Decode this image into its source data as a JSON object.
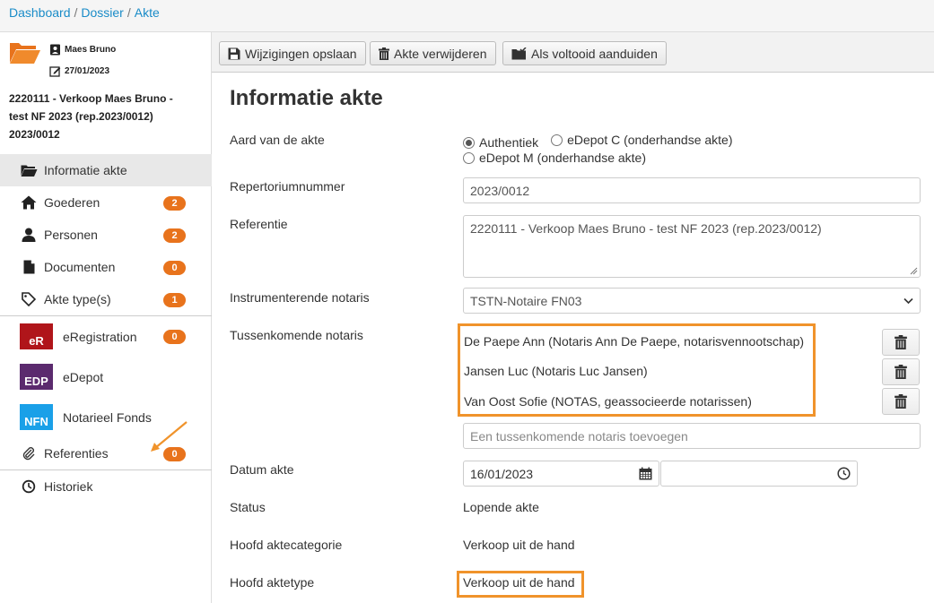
{
  "breadcrumb": {
    "items": [
      "Dashboard",
      "Dossier",
      "Akte"
    ]
  },
  "sidebar": {
    "user": "Maes Bruno",
    "date": "27/01/2023",
    "dossier_title": "2220111 - Verkoop Maes Bruno - test NF 2023 (rep.2023/0012) 2023/0012",
    "nav": [
      {
        "label": "Informatie akte",
        "icon": "folder-open-icon",
        "badge": ""
      },
      {
        "label": "Goederen",
        "icon": "home-icon",
        "badge": "2"
      },
      {
        "label": "Personen",
        "icon": "user-icon",
        "badge": "2"
      },
      {
        "label": "Documenten",
        "icon": "file-icon",
        "badge": "0"
      },
      {
        "label": "Akte type(s)",
        "icon": "tag-icon",
        "badge": "1"
      }
    ],
    "external": [
      {
        "label": "eRegistration",
        "logo": "eR",
        "color": "#b0151a",
        "badge": "0"
      },
      {
        "label": "eDepot",
        "logo": "EDP",
        "color": "#5b2a6e",
        "badge": ""
      },
      {
        "label": "Notarieel Fonds",
        "logo": "NFN",
        "color": "#1aa0e8",
        "badge": ""
      }
    ],
    "referenties": {
      "label": "Referenties",
      "badge": "0"
    },
    "historiek": {
      "label": "Historiek"
    }
  },
  "toolbar": {
    "save_label": "Wijzigingen opslaan",
    "delete_label": "Akte verwijderen",
    "complete_label": "Als voltooid aanduiden"
  },
  "form": {
    "title": "Informatie akte",
    "aard_label": "Aard van de akte",
    "aard_options": [
      "Authentiek",
      "eDepot C (onderhandse akte)",
      "eDepot M (onderhandse akte)"
    ],
    "aard_selected": "Authentiek",
    "repertorium_label": "Repertoriumnummer",
    "repertorium_value": "2023/0012",
    "referentie_label": "Referentie",
    "referentie_value": "2220111 - Verkoop Maes Bruno - test NF 2023 (rep.2023/0012)",
    "instr_label": "Instrumenterende notaris",
    "instr_value": "TSTN-Notaire FN03",
    "tussen_label": "Tussenkomende notaris",
    "tussen_list": [
      "De Paepe Ann (Notaris Ann De Paepe, notarisvennootschap)",
      "Jansen Luc (Notaris Luc Jansen)",
      "Van Oost Sofie (NOTAS, geassocieerde notarissen)"
    ],
    "tussen_placeholder": "Een tussenkomende notaris toevoegen",
    "datum_label": "Datum akte",
    "datum_value": "16/01/2023",
    "status_label": "Status",
    "status_value": "Lopende akte",
    "hoofdcat_label": "Hoofd aktecategorie",
    "hoofdcat_value": "Verkoop uit de hand",
    "hoofdtype_label": "Hoofd aktetype",
    "hoofdtype_value": "Verkoop uit de hand"
  },
  "colors": {
    "link": "#1a8cc8",
    "badge": "#e8731c",
    "highlight": "#f0932b"
  }
}
